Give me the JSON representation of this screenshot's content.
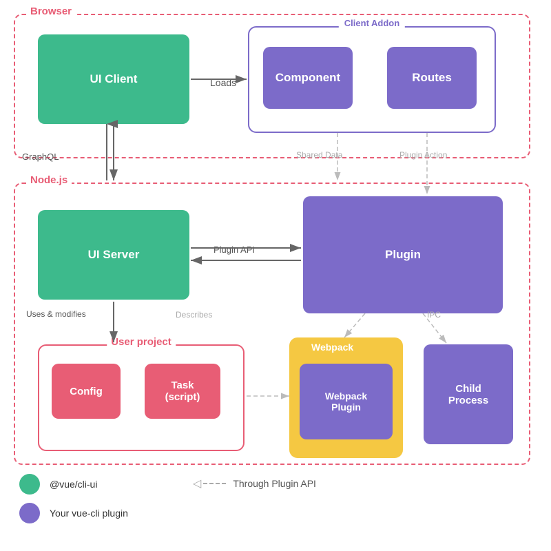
{
  "labels": {
    "browser": "Browser",
    "nodejs": "Node.js",
    "ui_client": "UI Client",
    "client_addon": "Client Addon",
    "component": "Component",
    "routes": "Routes",
    "ui_server": "UI Server",
    "plugin": "Plugin",
    "user_project": "User project",
    "config": "Config",
    "task_script": "Task\n(script)",
    "webpack": "Webpack",
    "webpack_plugin": "Webpack\nPlugin",
    "child_process": "Child\nProcess",
    "loads": "Loads",
    "graphql": "GraphQL",
    "shared_data": "Shared\nData",
    "plugin_action": "Plugin\nAction",
    "plugin_api": "Plugin API",
    "uses_modifies": "Uses &\nmodifies",
    "describes": "Describes",
    "ipc": "IPC",
    "legend_green": "@vue/cli-ui",
    "legend_purple": "Your vue-cli plugin",
    "legend_dashed": "Through Plugin API"
  },
  "colors": {
    "green": "#3dba8c",
    "purple": "#7c6bc9",
    "red_border": "#e85d75",
    "yellow": "#f5c842",
    "gray_arrow": "#b0b0b0",
    "dark_arrow": "#555"
  }
}
